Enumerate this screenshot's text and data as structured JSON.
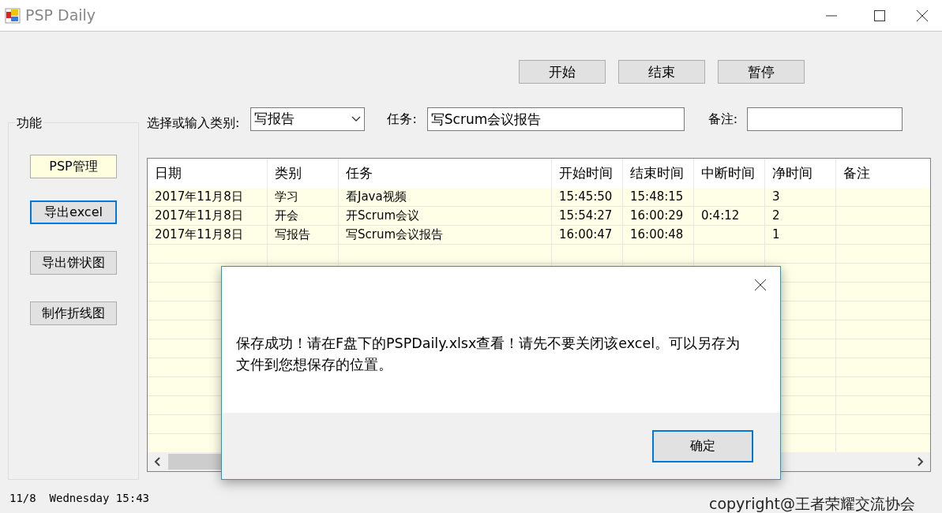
{
  "window": {
    "title": "PSP Daily"
  },
  "timer_buttons": [
    {
      "label": "开始"
    },
    {
      "label": "结束"
    },
    {
      "label": "暂停"
    }
  ],
  "function_group": {
    "title": "功能",
    "buttons": [
      {
        "label": "PSP管理",
        "highlighted": true,
        "focused": false
      },
      {
        "label": "导出excel",
        "highlighted": false,
        "focused": true
      },
      {
        "label": "导出饼状图",
        "highlighted": false,
        "focused": false
      },
      {
        "label": "制作折线图",
        "highlighted": false,
        "focused": false
      }
    ]
  },
  "form": {
    "category_label": "选择或输入类别:",
    "category_value": "写报告",
    "task_label": "任务:",
    "task_value": "写Scrum会议报告",
    "note_label": "备注:"
  },
  "table": {
    "columns": [
      "日期",
      "类别",
      "任务",
      "开始时间",
      "结束时间",
      "中断时间",
      "净时间",
      "备注"
    ],
    "rows": [
      {
        "date": "2017年11月8日",
        "category": "学习",
        "task": "看Java视频",
        "start": "15:45:50",
        "end": "15:48:15",
        "net": "3"
      },
      {
        "date": "2017年11月8日",
        "category": "开会",
        "task": "开Scrum会议",
        "start": "15:54:27",
        "end": "16:00:29",
        "interruption": "0:4:12",
        "net": "2"
      },
      {
        "date": "2017年11月8日",
        "category": "写报告",
        "task": "写Scrum会议报告",
        "start": "16:00:47",
        "end": "16:00:48",
        "net": "1"
      }
    ]
  },
  "status_bar": {
    "datetime": "11/8  Wednesday 15:43",
    "copyright": "copyright@王者荣耀交流协会"
  },
  "dialog": {
    "message": "保存成功！请在F盘下的PSPDaily.xlsx查看！请先不要关闭该excel。可以另存为文件到您想保存的位置。",
    "ok_button": {
      "label": "确定",
      "focused": true
    }
  }
}
